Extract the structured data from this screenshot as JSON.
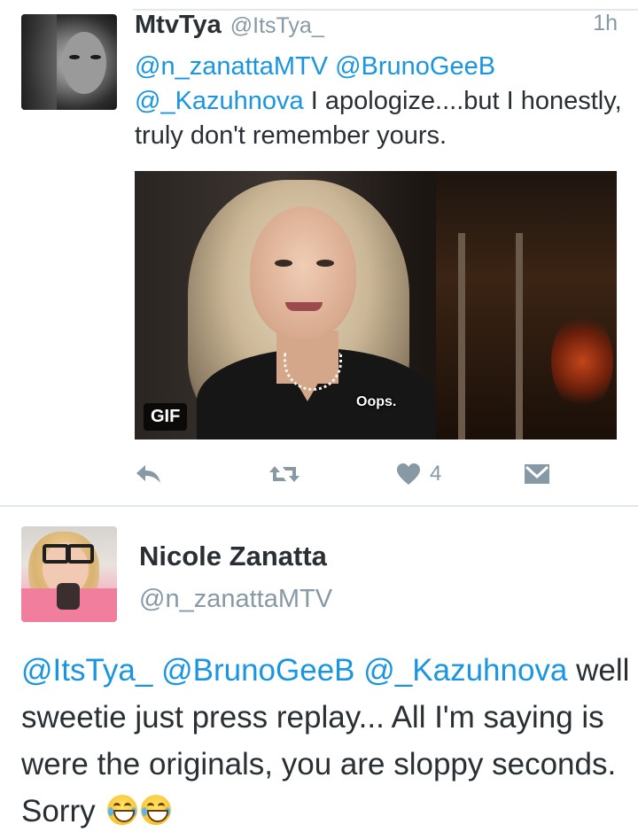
{
  "tweet1": {
    "author_name": "MtvTya",
    "author_handle": "@ItsTya_",
    "timestamp": "1h",
    "mentions": [
      "@n_zanattaMTV",
      "@BrunoGeeB",
      "@_Kazuhnova"
    ],
    "text": "I apologize....but I honestly, truly don't remember yours.",
    "media": {
      "badge": "GIF",
      "caption": "Oops."
    },
    "actions": {
      "reply_icon": "reply-icon",
      "retweet_icon": "retweet-icon",
      "like_icon": "heart-icon",
      "like_count": "4",
      "message_icon": "direct-message-icon"
    }
  },
  "tweet2": {
    "author_name": "Nicole Zanatta",
    "author_handle": "@n_zanattaMTV",
    "mentions": [
      "@ItsTya_",
      "@BrunoGeeB",
      "@_Kazuhnova"
    ],
    "text": "well sweetie just press replay... All I'm saying is were the originals, you are sloppy seconds. Sorry",
    "emoji": [
      "face-with-tears-of-joy",
      "face-with-tears-of-joy"
    ]
  },
  "colors": {
    "link": "#1b95e0",
    "secondary_text": "#8899a6",
    "primary_text": "#292f33",
    "divider": "#e1e8ed"
  }
}
